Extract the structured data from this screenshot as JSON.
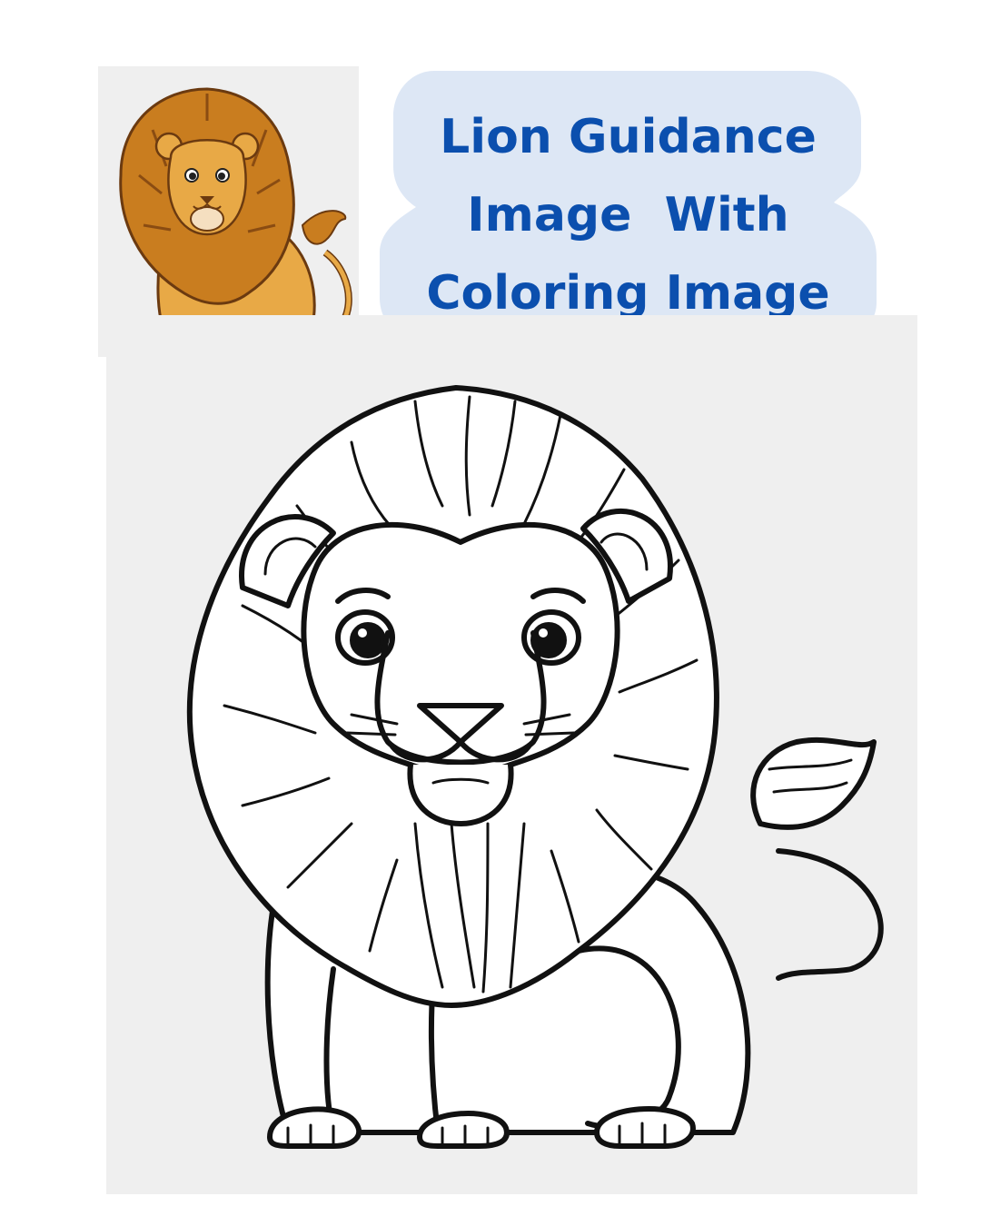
{
  "title": {
    "lines": [
      "Lion Guidance",
      "Image  With",
      "Coloring Image"
    ]
  },
  "colors": {
    "title_text": "#0b4fae",
    "title_bg": "#dde7f5",
    "panel_bg": "#efefef",
    "lion_mane": "#c97d1f",
    "lion_body": "#e8a946",
    "outline": "#111111"
  },
  "images": {
    "guidance_image": "colored-lion-illustration",
    "coloring_image": "lion-line-art-coloring-page"
  }
}
